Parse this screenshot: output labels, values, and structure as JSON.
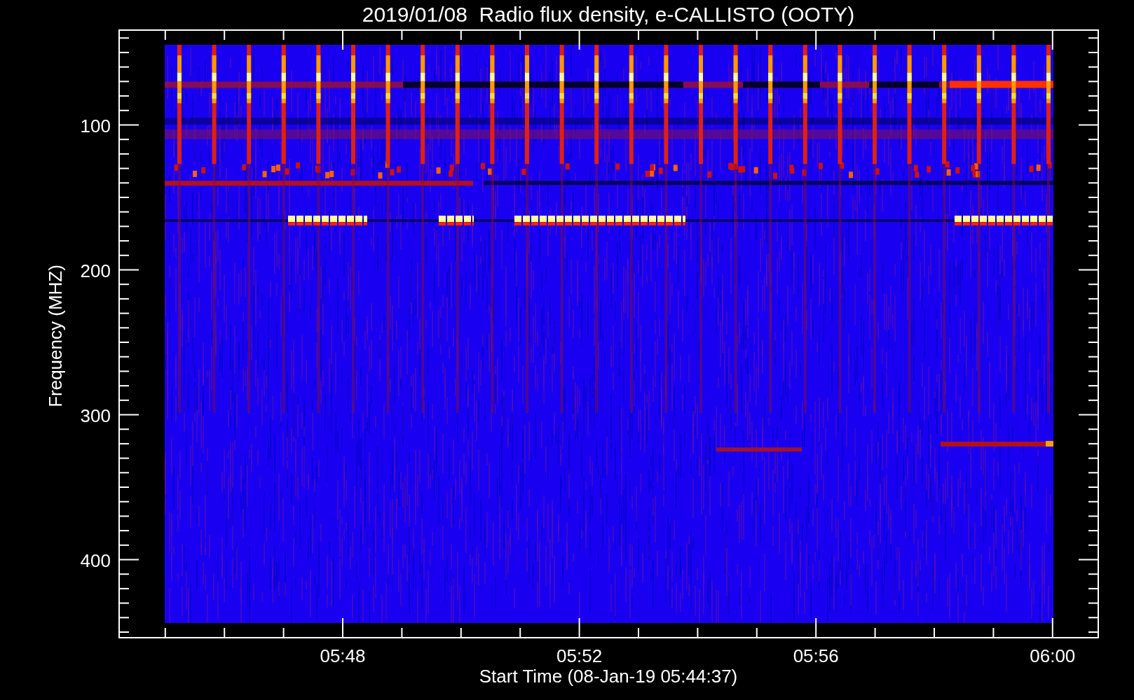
{
  "plot": {
    "title": "2019/01/08  Radio flux density, e-CALLISTO (OOTY)",
    "y_axis": {
      "label": "Frequency (MHZ)",
      "ticks": [
        "100",
        "200",
        "300",
        "400"
      ]
    },
    "x_axis": {
      "label": "Start Time (08-Jan-19 05:44:37)",
      "ticks": [
        "05:48",
        "05:52",
        "05:56",
        "06:00"
      ]
    }
  }
}
